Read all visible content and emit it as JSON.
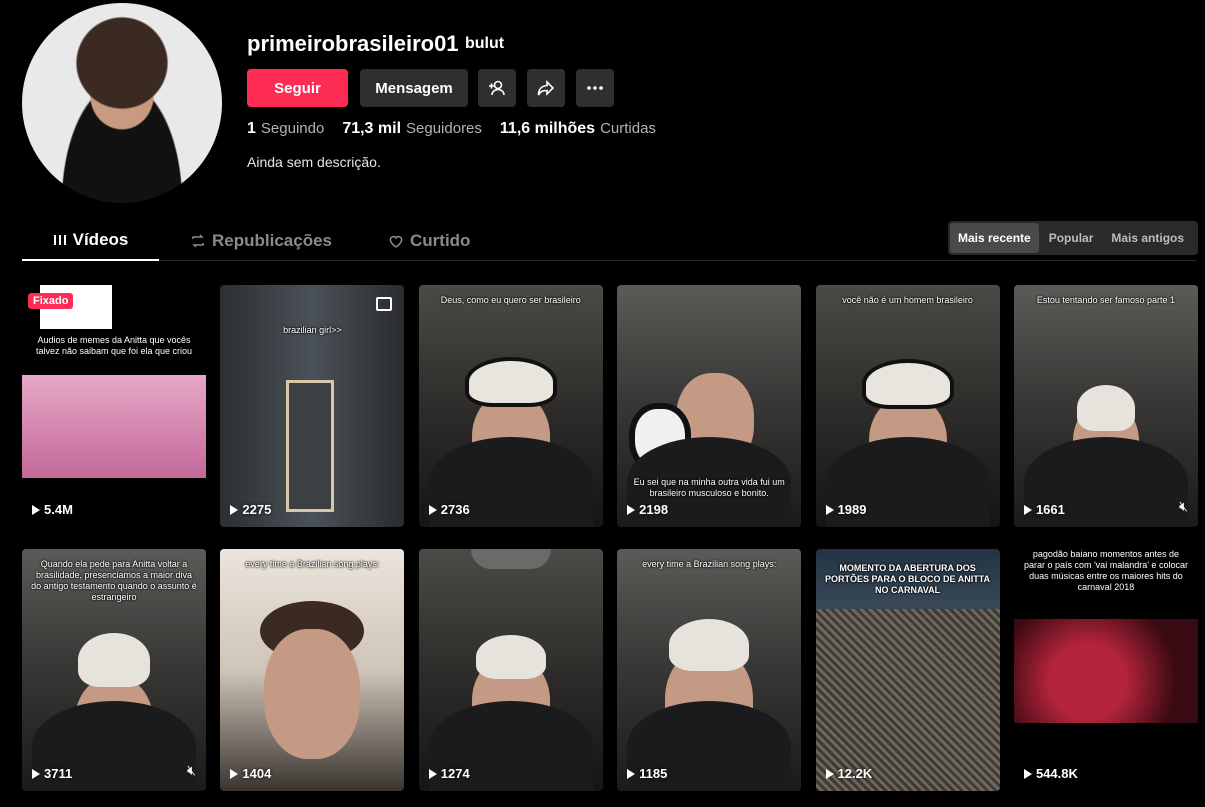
{
  "profile": {
    "username": "primeirobrasileiro01",
    "nickname": "bulut",
    "follow_label": "Seguir",
    "message_label": "Mensagem",
    "bio": "Ainda sem descrição.",
    "stats": [
      {
        "value": "1",
        "label": "Seguindo"
      },
      {
        "value": "71,3 mil",
        "label": "Seguidores"
      },
      {
        "value": "11,6 milhões",
        "label": "Curtidas"
      }
    ]
  },
  "tabs": [
    {
      "label": "Vídeos",
      "icon": "grid-bars-icon"
    },
    {
      "label": "Republicações",
      "icon": "repost-icon"
    },
    {
      "label": "Curtido",
      "icon": "heart-outline-icon"
    }
  ],
  "sort": [
    "Mais recente",
    "Popular",
    "Mais antigos"
  ],
  "pinned_label": "Fixado",
  "videos": [
    {
      "views": "5.4M",
      "caption": "Audios de memes da Anitta que vocês talvez não saibam que foi ela que criou",
      "pinned": true
    },
    {
      "views": "2275",
      "caption": "brazilian girl>>",
      "photo": true
    },
    {
      "views": "2736",
      "caption": "Deus, como eu quero ser brasileiro"
    },
    {
      "views": "2198",
      "caption": "Eu sei que na minha outra vida fui um brasileiro musculoso e bonito."
    },
    {
      "views": "1989",
      "caption": "você não é um homem brasileiro"
    },
    {
      "views": "1661",
      "caption": "Estou tentando ser famoso parte 1",
      "muted": true
    },
    {
      "views": "3711",
      "caption": "Quando ela pede para Anitta voltar a brasilidade, presenciamos a maior diva do antigo testamento quando o assunto é estrangeiro",
      "muted": true
    },
    {
      "views": "1404",
      "caption": "every time a Brazilian song plays:"
    },
    {
      "views": "1274",
      "caption": ""
    },
    {
      "views": "1185",
      "caption": "every time a Brazilian song plays:"
    },
    {
      "views": "12.2K",
      "caption": "MOMENTO DA ABERTURA DOS PORTÕES PARA O BLOCO DE ANITTA NO CARNAVAL"
    },
    {
      "views": "544.8K",
      "caption": "pagodão baiano momentos antes de parar o país com 'vai malandra' e colocar duas músicas entre os maiores hits do carnaval 2018"
    }
  ],
  "colors": {
    "accent": "#fe2c55",
    "background": "#000000",
    "button": "#2f2f2f"
  }
}
